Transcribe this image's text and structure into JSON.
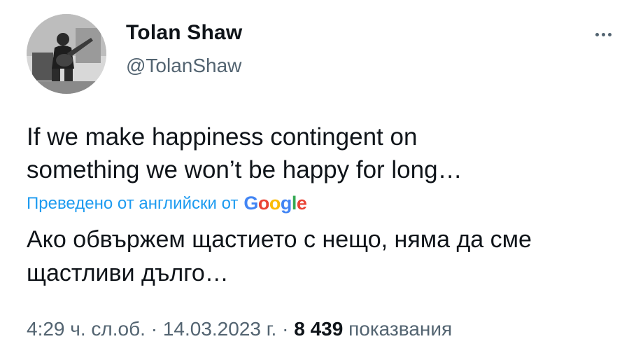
{
  "author": {
    "display_name": "Tolan Shaw",
    "handle": "@TolanShaw"
  },
  "tweet": {
    "original_line_1": "If we make happiness contingent on",
    "original_line_2": "something we won’t be happy for long…",
    "translated_by_label": "Преведено от английски от",
    "translation_provider": [
      "G",
      "o",
      "o",
      "g",
      "l",
      "e"
    ],
    "translated_line_1": "Ако обвържем щастието с нещо, няма да сме",
    "translated_line_2": "щастливи дълго…"
  },
  "meta": {
    "time": "4:29 ч. сл.об.",
    "separator": "·",
    "date": "14.03.2023 г.",
    "views_count": "8 439",
    "views_label": "показвания"
  },
  "icons": {
    "more": "more-horizontal-icon",
    "avatar": "profile-photo"
  },
  "colors": {
    "text_primary": "#0f1419",
    "text_secondary": "#536471",
    "link": "#1d9bf0",
    "google": [
      "#4285f4",
      "#ea4335",
      "#fbbc05",
      "#4285f4",
      "#34a853",
      "#ea4335"
    ]
  }
}
